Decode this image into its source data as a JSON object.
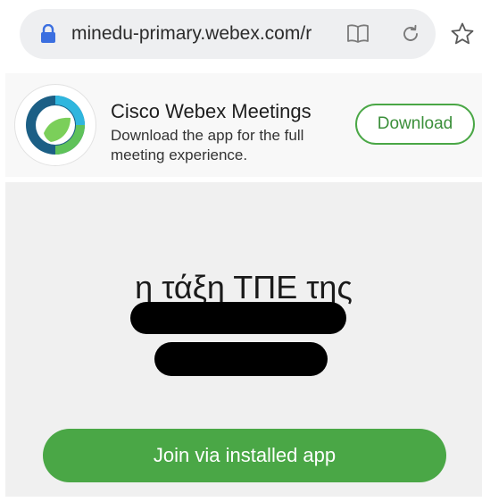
{
  "browser": {
    "url": "minedu-primary.webex.com/r",
    "icons": {
      "lock": "lock-icon",
      "reader": "reader-mode-icon",
      "reload": "reload-icon",
      "bookmark": "star-icon"
    }
  },
  "banner": {
    "app_name": "Cisco Webex Meetings",
    "description": "Download the app for the full meeting experience.",
    "download_label": "Download",
    "logo": "webex-logo-icon"
  },
  "meeting": {
    "title": "η τάξη ΤΠΕ της",
    "join_label": "Join via installed app"
  },
  "colors": {
    "accent_green": "#4aa746",
    "lock_blue": "#3b6fe0",
    "panel_bg": "#f0f0f0",
    "urlbar_bg": "#eeeff1"
  }
}
